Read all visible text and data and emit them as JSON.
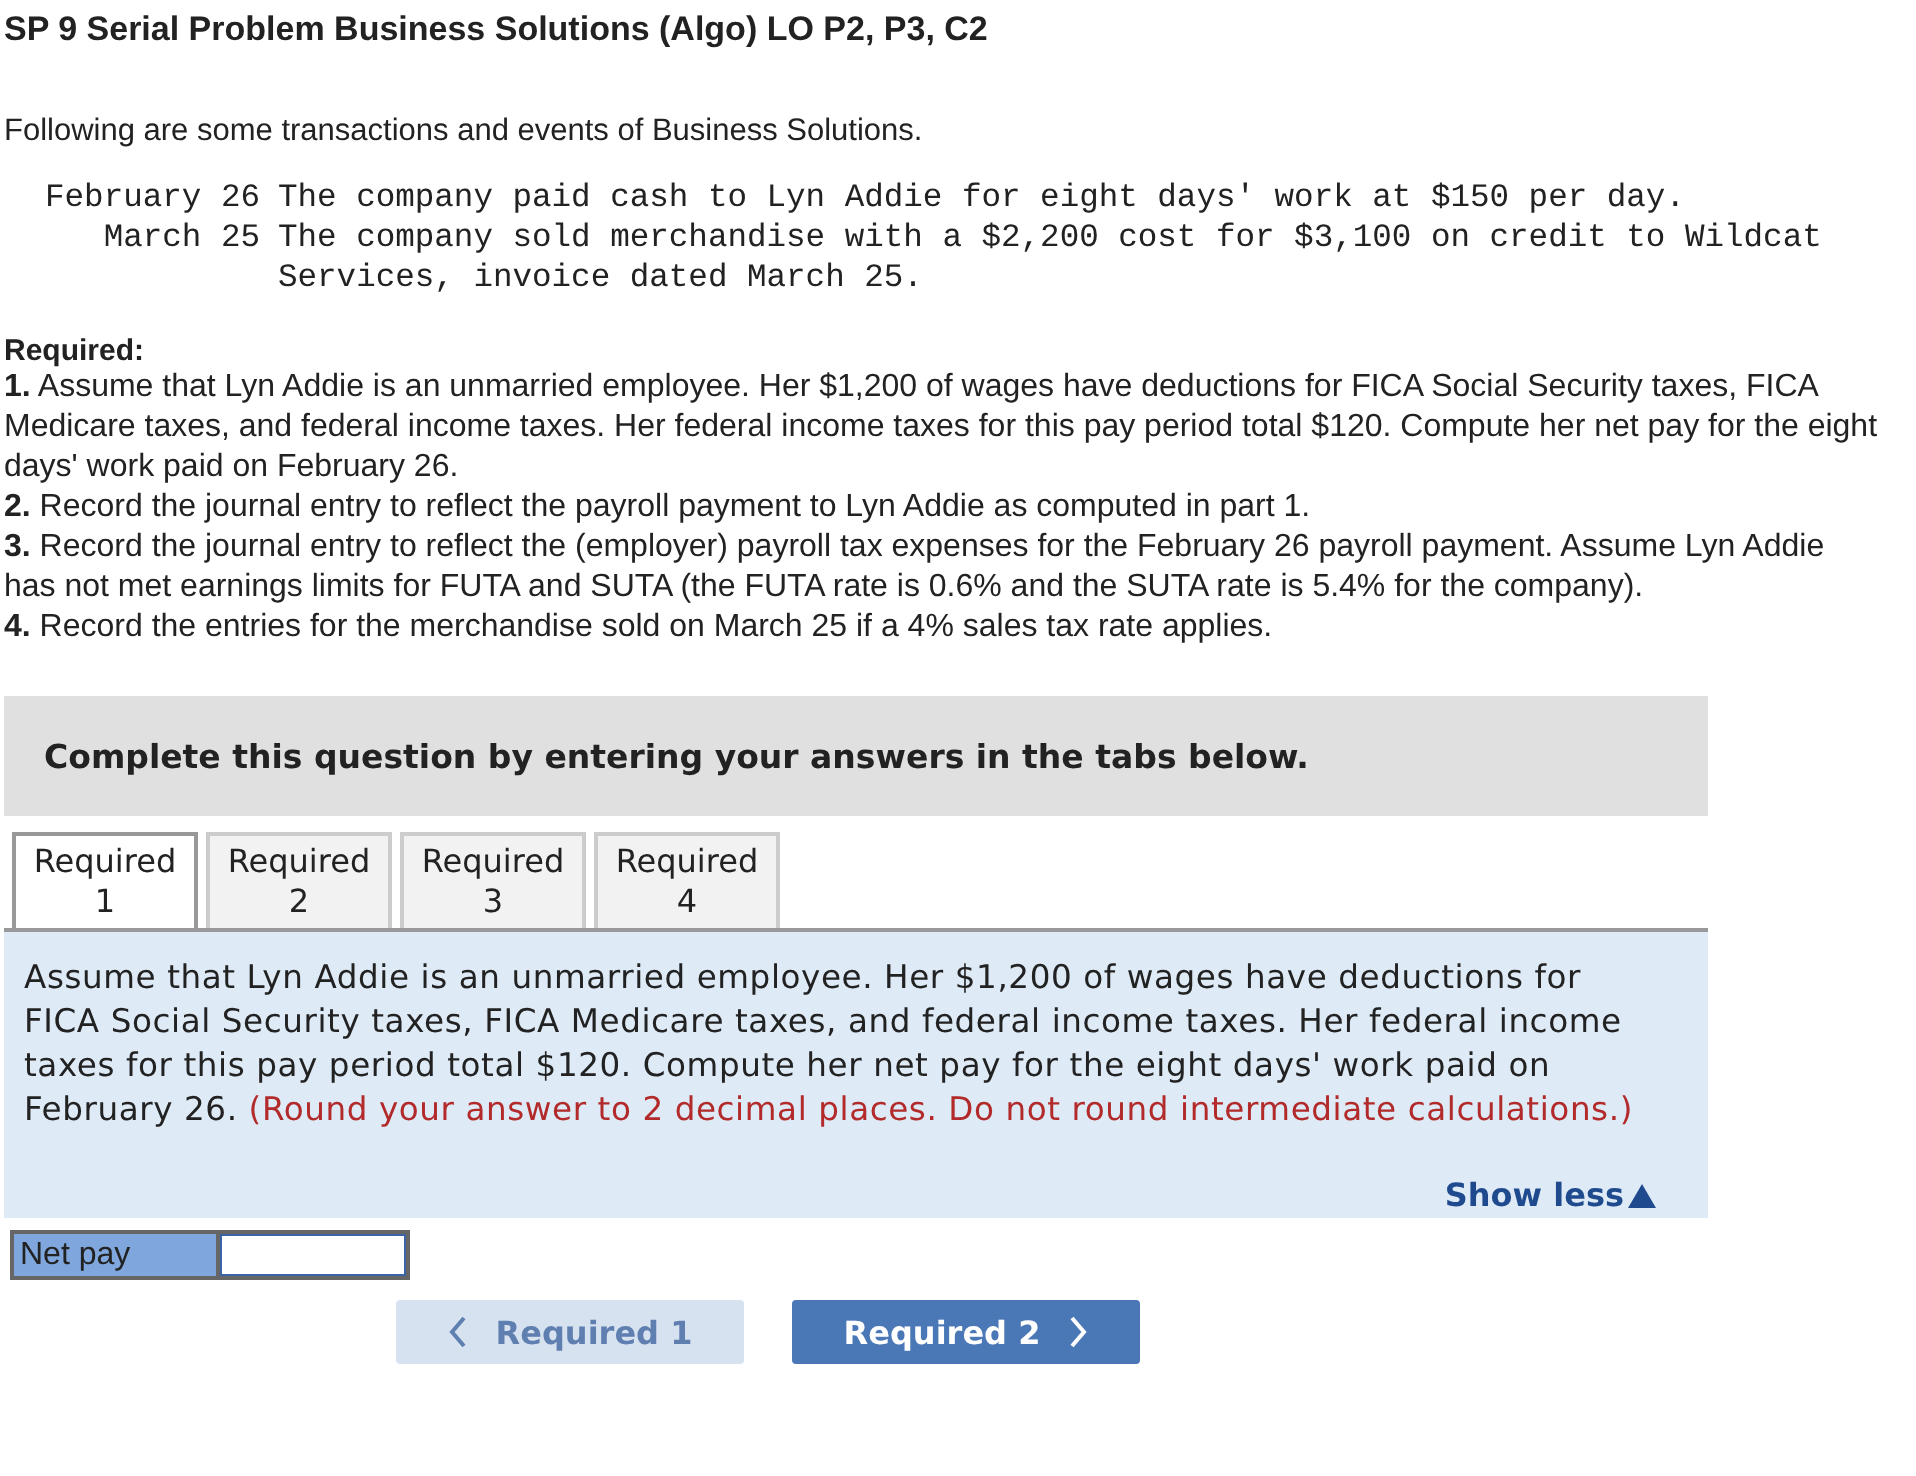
{
  "title": "SP 9 Serial Problem Business Solutions (Algo) LO P2, P3, C2",
  "intro": "Following are some transactions and events of Business Solutions.",
  "transactions": [
    {
      "date": "February 26",
      "text": "The company paid cash to Lyn Addie for eight days' work at $150 per day."
    },
    {
      "date": "March 25",
      "text": "The company sold merchandise with a $2,200 cost for $3,100 on credit to Wildcat Services, invoice dated March 25."
    }
  ],
  "required_heading": "Required:",
  "requirements": [
    "**1.** Assume that Lyn Addie is an unmarried employee. Her $1,200 of wages have deductions for FICA Social Security taxes, FICA Medicare taxes, and federal income taxes. Her federal income taxes for this pay period total $120. Compute her net pay for the eight days' work paid on February 26.",
    "**2.** Record the journal entry to reflect the payroll payment to Lyn Addie as computed in part 1.",
    "**3.** Record the journal entry to reflect the (employer) payroll tax expenses for the February 26 payroll payment. Assume Lyn Addie has not met earnings limits for FUTA and SUTA (the FUTA rate is 0.6% and the SUTA rate is 5.4% for the company).",
    "**4.** Record the entries for the merchandise sold on March 25 if a 4% sales tax rate applies."
  ],
  "banner": "Complete this question by entering your answers in the tabs below.",
  "tabs": [
    {
      "label": "Required 1",
      "selected": true
    },
    {
      "label": "Required 2",
      "selected": false
    },
    {
      "label": "Required 3",
      "selected": false
    },
    {
      "label": "Required 4",
      "selected": false
    }
  ],
  "panel": {
    "text": "Assume that Lyn Addie is an unmarried employee. Her $1,200 of wages have deductions for FICA Social Security taxes, FICA Medicare taxes, and federal income taxes. Her federal income taxes for this pay period total $120. Compute her net pay for the eight days' work paid on February 26.",
    "note": "(Round your answer to 2 decimal places. Do not round intermediate calculations.)",
    "toggle": "Show less"
  },
  "answer": {
    "label": "Net pay"
  },
  "nav": [
    {
      "kind": "prev",
      "label": "Required 1",
      "disabled": true
    },
    {
      "kind": "next",
      "label": "Required 2",
      "disabled": false
    }
  ]
}
